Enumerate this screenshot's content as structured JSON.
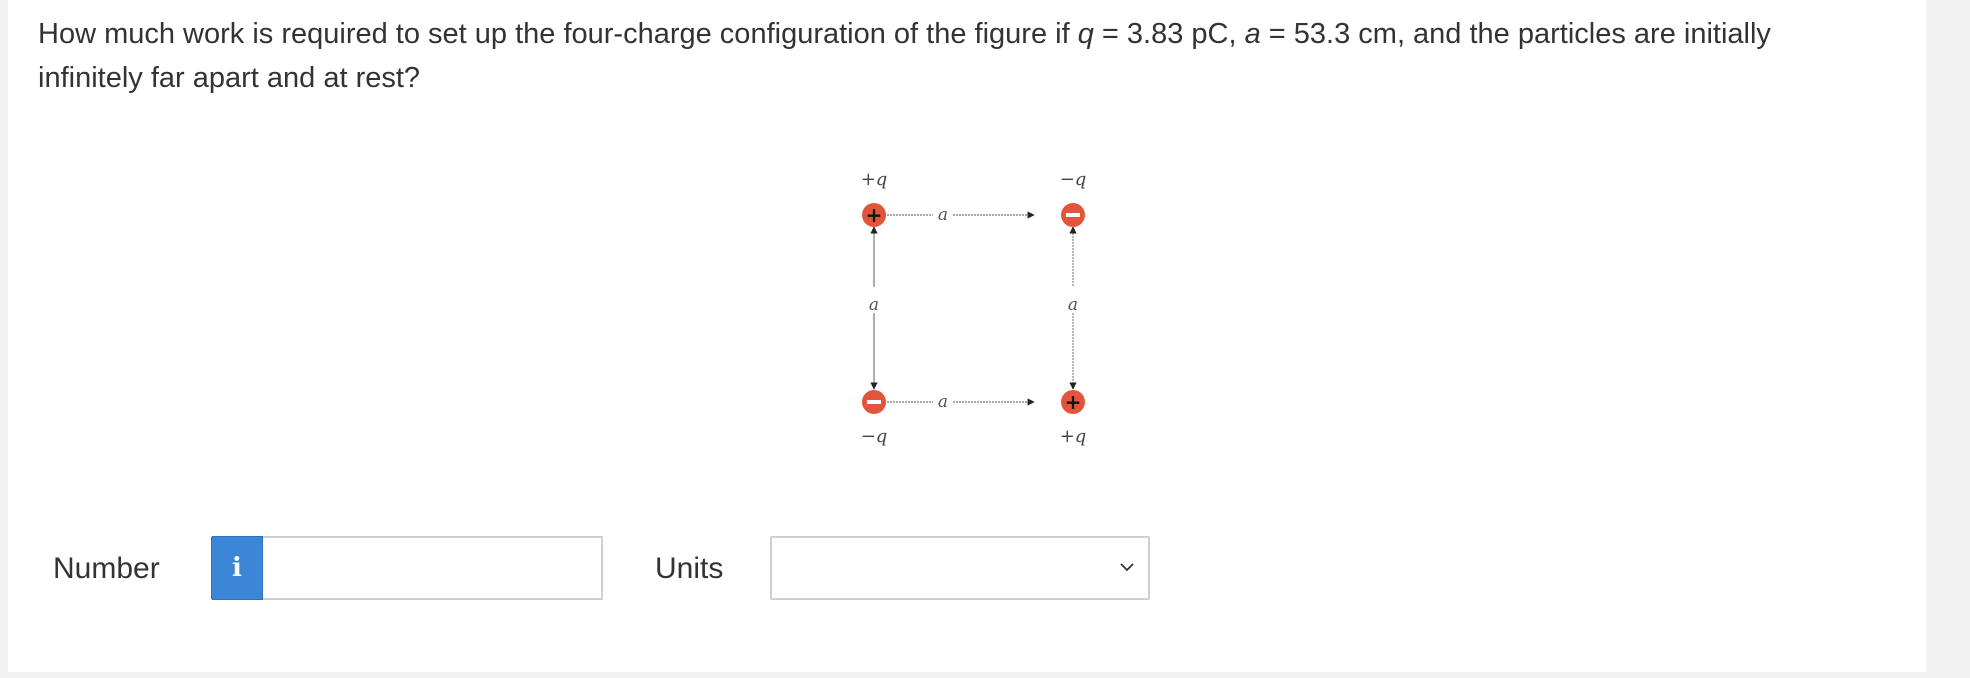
{
  "question": {
    "part1": "How much work is required to set up the four-charge configuration of the figure if ",
    "q_var": "q",
    "eq1": " = 3.83 pC, ",
    "a_var": "a",
    "eq2": " = 53.3 cm, and the particles are initially infinitely far apart and at rest?"
  },
  "figure": {
    "top_left_label": "+q",
    "top_right_label": "−q",
    "bottom_left_label": "−q",
    "bottom_right_label": "+q",
    "top_side_label": "a",
    "bottom_side_label": "a",
    "left_side_label": "a",
    "right_side_label": "a",
    "plus_sign": "+",
    "minus_sign": "−",
    "charge_color": "#e2543b"
  },
  "answer": {
    "number_label": "Number",
    "info_icon": "i",
    "number_value": "",
    "units_label": "Units",
    "units_value": ""
  },
  "colors": {
    "info_button": "#3b86d6",
    "text": "#333333"
  }
}
